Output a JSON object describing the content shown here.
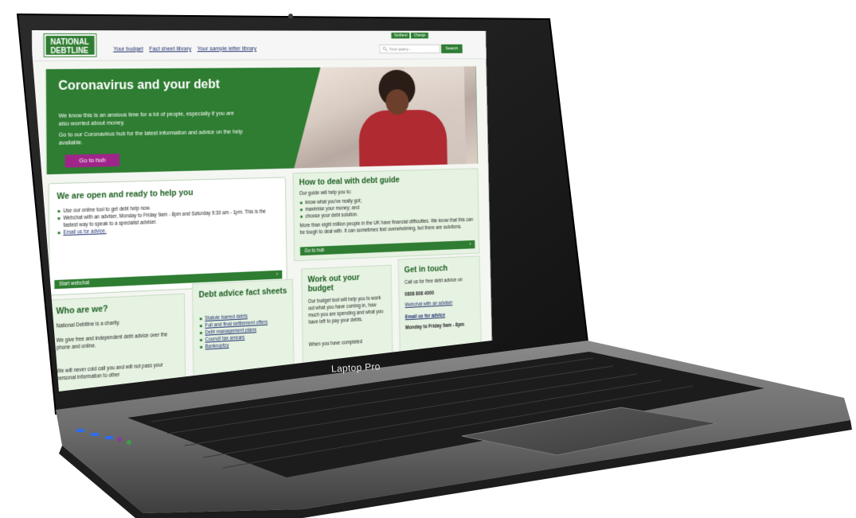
{
  "device": {
    "brand": "Laptop Pro"
  },
  "site": {
    "logo_line1": "NATIONAL",
    "logo_line2": "DEBTLINE",
    "nav": [
      "Your budget",
      "Fact sheet library",
      "Your sample letter library"
    ],
    "top_buttons": [
      "Scotland",
      "Change"
    ],
    "search_placeholder": "Your query...",
    "search_label": "Search"
  },
  "hero": {
    "title": "Coronavirus and your debt",
    "text1": "We know this is an anxious time for a lot of people, especially if you are also worried about money.",
    "text2": "Go to our Coronavirus hub for the latest information and advice on the help available.",
    "button": "Go to hub"
  },
  "open_card": {
    "title": "We are open and ready to help you",
    "items": [
      "Use our online tool to get debt help now.",
      "Webchat with an adviser, Monday to Friday 9am - 8pm and Saturday 9:30 am - 1pm. This is the fastest way to speak to a specialist adviser.",
      "Email us for advice."
    ],
    "bar": "Start webchat"
  },
  "guide_card": {
    "title": "How to deal with debt guide",
    "intro": "Our guide will help you to:",
    "items": [
      "know what you've really got;",
      "maximise your money; and",
      "choose your debt solution."
    ],
    "body": "More than eight million people in the UK have financial difficulties. We know that this can be tough to deal with. It can sometimes feel overwhelming, but there are solutions.",
    "bar": "Go to hub"
  },
  "who_card": {
    "title": "Who are we?",
    "p1": "National Debtline is a charity.",
    "p2": "We give free and independent debt advice over the phone and online.",
    "p3": "We will never cold call you and will not pass your personal information to other"
  },
  "facts_card": {
    "title": "Debt advice fact sheets",
    "items": [
      "Statute barred debts",
      "Full and final settlement offers",
      "Debt management plans",
      "Council tax arrears",
      "Bankruptcy"
    ]
  },
  "budget_card": {
    "title": "Work out your budget",
    "p1": "Our budget tool will help you to work out what you have coming in, how much you are spending and what you have left to pay your debts.",
    "p2": "When you have completed"
  },
  "touch_card": {
    "title": "Get in touch",
    "p1": "Call us for free debt advice on",
    "phone": "0808 808 4000",
    "p2": "Webchat with an adviser",
    "email": "Email us for advice",
    "hours": "Monday to Friday 9am - 8pm"
  },
  "colors": {
    "brand_green": "#2e7d32",
    "accent_purple": "#a0258a",
    "card_bg": "#e6f2e2"
  }
}
